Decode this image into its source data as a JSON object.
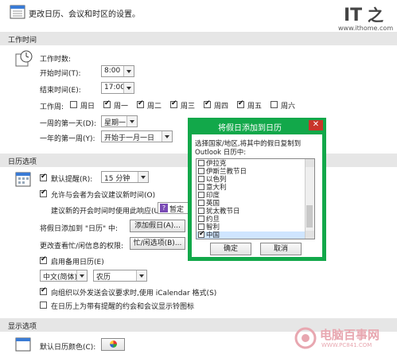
{
  "intro": {
    "text": "更改日历、会议和时区的设置。"
  },
  "logo": {
    "text": "IT之家",
    "url": "www.ithome.com"
  },
  "work_time": {
    "header": "工作时间",
    "label": "工作时数:",
    "start_label": "开始时间(T):",
    "start_value": "8:00",
    "end_label": "结束时间(E):",
    "end_value": "17:00",
    "workweek_label": "工作周:",
    "days": [
      {
        "label": "周日",
        "checked": false
      },
      {
        "label": "周一",
        "checked": true
      },
      {
        "label": "周二",
        "checked": true
      },
      {
        "label": "周三",
        "checked": true
      },
      {
        "label": "周四",
        "checked": true
      },
      {
        "label": "周五",
        "checked": true
      },
      {
        "label": "周六",
        "checked": false
      }
    ],
    "first_day_label": "一周的第一天(D):",
    "first_day_value": "星期一",
    "first_week_label": "一年的第一周(Y):",
    "first_week_value": "开始于一月一日"
  },
  "calendar_options": {
    "header": "日历选项",
    "reminder_label": "默认提醒(R):",
    "reminder_value": "15 分钟",
    "allow_propose": "允许与会者为会议建议新时间(O)",
    "propose_response_label": "建议新的开会时间时使用此响应(U):",
    "propose_response_value": "暂定",
    "add_holidays_label": "将假日添加到 \"日历\" 中:",
    "add_holidays_button": "添加假日(A)...",
    "freebusy_label": "更改查看忙/闲信息的权限:",
    "freebusy_button": "忙/闲选项(B)...",
    "alt_calendar": "启用备用日历(E)",
    "alt_lang": "中文(简体)",
    "alt_type": "农历",
    "icalendar": "向组织以外发送会议要求时,使用 iCalendar 格式(S)",
    "bell_icon": "在日历上为带有提醒的约会和会议显示铃图标"
  },
  "display_options": {
    "header": "显示选项",
    "default_color_label": "默认日历颜色(C):"
  },
  "dialog": {
    "title": "将假日添加到日历",
    "close": "✕",
    "instruction_line1": "选择国家/地区,将其中的假日复制到",
    "instruction_line2": "Outlook 日历中:",
    "countries": [
      {
        "label": "伊拉克",
        "checked": false
      },
      {
        "label": "伊斯兰教节日",
        "checked": false
      },
      {
        "label": "以色列",
        "checked": false
      },
      {
        "label": "意大利",
        "checked": false
      },
      {
        "label": "印度",
        "checked": false
      },
      {
        "label": "英国",
        "checked": false
      },
      {
        "label": "犹太教节日",
        "checked": false
      },
      {
        "label": "约旦",
        "checked": false
      },
      {
        "label": "智利",
        "checked": false
      },
      {
        "label": "中国",
        "checked": true
      }
    ],
    "ok": "确定",
    "cancel": "取消"
  },
  "watermark": {
    "text": "电脑百事网",
    "url": "WWW.PC841.COM"
  },
  "colors": {
    "dialog_green": "#12a84a",
    "close_red": "#c9352a",
    "section_bg": "#e6e6e6",
    "selection": "#cfe5ff"
  }
}
